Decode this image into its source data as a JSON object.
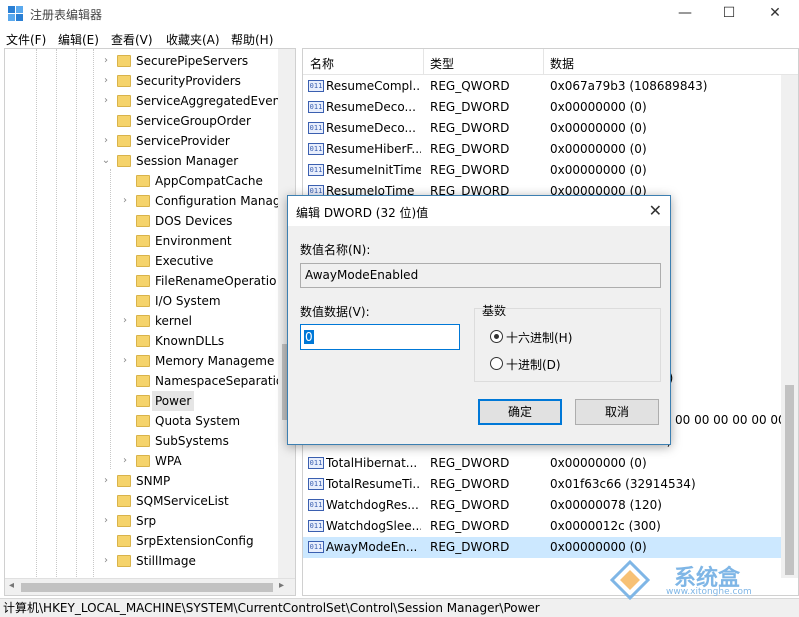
{
  "window": {
    "title": "注册表编辑器",
    "minimize_glyph": "—",
    "maximize_glyph": "☐",
    "close_glyph": "✕"
  },
  "menu": [
    "文件(F)",
    "编辑(E)",
    "查看(V)",
    "收藏夹(A)",
    "帮助(H)"
  ],
  "tree": {
    "items": [
      {
        "label": "SecurePipeServers",
        "level": 1,
        "expander": "›"
      },
      {
        "label": "SecurityProviders",
        "level": 1,
        "expander": "›"
      },
      {
        "label": "ServiceAggregatedEven",
        "level": 1,
        "expander": "›"
      },
      {
        "label": "ServiceGroupOrder",
        "level": 1,
        "expander": ""
      },
      {
        "label": "ServiceProvider",
        "level": 1,
        "expander": "›"
      },
      {
        "label": "Session Manager",
        "level": 1,
        "expander": "⌄"
      },
      {
        "label": "AppCompatCache",
        "level": 2,
        "expander": ""
      },
      {
        "label": "Configuration Manag",
        "level": 2,
        "expander": "›"
      },
      {
        "label": "DOS Devices",
        "level": 2,
        "expander": ""
      },
      {
        "label": "Environment",
        "level": 2,
        "expander": ""
      },
      {
        "label": "Executive",
        "level": 2,
        "expander": ""
      },
      {
        "label": "FileRenameOperatio",
        "level": 2,
        "expander": ""
      },
      {
        "label": "I/O System",
        "level": 2,
        "expander": ""
      },
      {
        "label": "kernel",
        "level": 2,
        "expander": "›"
      },
      {
        "label": "KnownDLLs",
        "level": 2,
        "expander": ""
      },
      {
        "label": "Memory Manageme",
        "level": 2,
        "expander": "›"
      },
      {
        "label": "NamespaceSeparatio",
        "level": 2,
        "expander": ""
      },
      {
        "label": "Power",
        "level": 2,
        "expander": "",
        "selected": true
      },
      {
        "label": "Quota System",
        "level": 2,
        "expander": ""
      },
      {
        "label": "SubSystems",
        "level": 2,
        "expander": ""
      },
      {
        "label": "WPA",
        "level": 2,
        "expander": "›"
      },
      {
        "label": "SNMP",
        "level": 1,
        "expander": "›"
      },
      {
        "label": "SQMServiceList",
        "level": 1,
        "expander": ""
      },
      {
        "label": "Srp",
        "level": 1,
        "expander": "›"
      },
      {
        "label": "SrpExtensionConfig",
        "level": 1,
        "expander": ""
      },
      {
        "label": "StillImage",
        "level": 1,
        "expander": "›"
      }
    ]
  },
  "list": {
    "columns": [
      "名称",
      "类型",
      "数据"
    ],
    "rows": [
      {
        "name": "ResumeCompl...",
        "type": "REG_QWORD",
        "data": "0x067a79b3 (108689843)"
      },
      {
        "name": "ResumeDeco...",
        "type": "REG_DWORD",
        "data": "0x00000000 (0)"
      },
      {
        "name": "ResumeDeco...",
        "type": "REG_DWORD",
        "data": "0x00000000 (0)"
      },
      {
        "name": "ResumeHiberF...",
        "type": "REG_DWORD",
        "data": "0x00000000 (0)"
      },
      {
        "name": "ResumeInitTime",
        "type": "REG_DWORD",
        "data": "0x00000000 (0)"
      },
      {
        "name": "ResumeIoTime",
        "type": "REG_DWORD",
        "data": "0x00000000 (0)"
      }
    ],
    "partial_data": {
      "a": "0)",
      "b": "00 00 00 00 00 00",
      "c": "7)"
    },
    "rows_bottom": [
      {
        "name": "TotalHibernat...",
        "type": "REG_DWORD",
        "data": "0x00000000 (0)"
      },
      {
        "name": "TotalResumeTi...",
        "type": "REG_DWORD",
        "data": "0x01f63c66 (32914534)"
      },
      {
        "name": "WatchdogRes...",
        "type": "REG_DWORD",
        "data": "0x00000078 (120)"
      },
      {
        "name": "WatchdogSlee...",
        "type": "REG_DWORD",
        "data": "0x0000012c (300)"
      },
      {
        "name": "AwayModeEn...",
        "type": "REG_DWORD",
        "data": "0x00000000 (0)",
        "selected": true
      }
    ],
    "icon_text": "011"
  },
  "status": {
    "path": "计算机\\HKEY_LOCAL_MACHINE\\SYSTEM\\CurrentControlSet\\Control\\Session Manager\\Power"
  },
  "dialog": {
    "title": "编辑 DWORD (32 位)值",
    "name_label": "数值名称(N):",
    "name_value": "AwayModeEnabled",
    "data_label": "数值数据(V):",
    "data_value": "0",
    "base_label": "基数",
    "hex_label": "十六进制(H)",
    "dec_label": "十进制(D)",
    "base_selected": "hex",
    "ok_label": "确定",
    "cancel_label": "取消"
  },
  "watermark": {
    "brand": "系统盒",
    "url": "www.xitonghe.com"
  },
  "colors": {
    "accent": "#0078d7",
    "selection": "#cce8ff",
    "folder": "#f5d36b"
  }
}
